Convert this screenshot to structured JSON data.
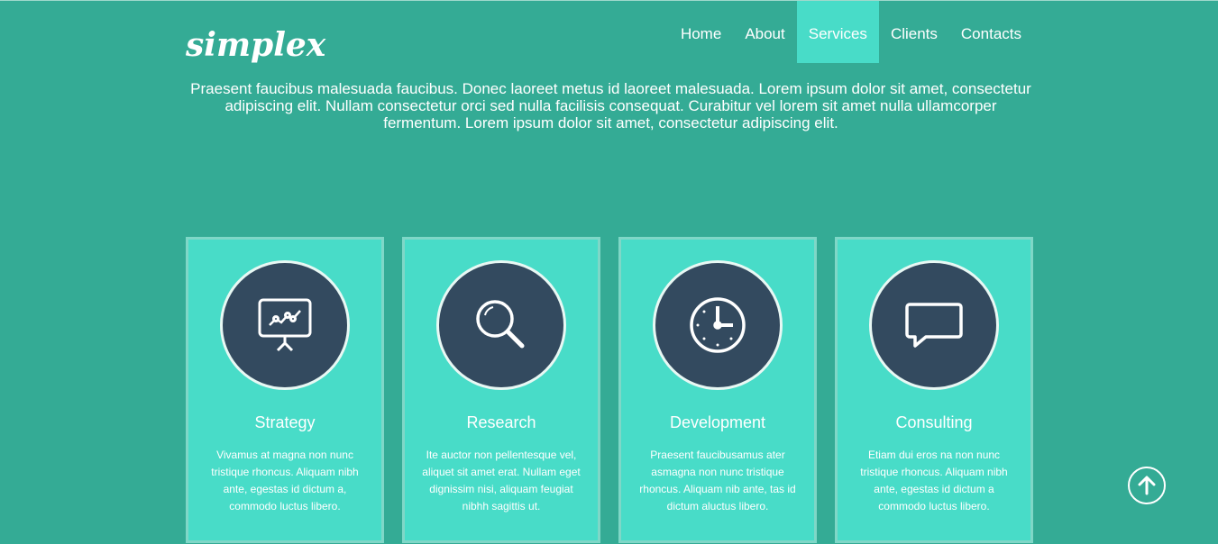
{
  "brand": {
    "logo": "simplex"
  },
  "nav": [
    {
      "label": "Home"
    },
    {
      "label": "About"
    },
    {
      "label": "Services"
    },
    {
      "label": "Clients"
    },
    {
      "label": "Contacts"
    }
  ],
  "intro": "Praesent faucibus malesuada faucibus. Donec laoreet metus id laoreet malesuada. Lorem ipsum dolor sit amet, consectetur adipiscing elit. Nullam consectetur orci sed nulla facilisis consequat. Curabitur vel lorem sit amet nulla ullamcorper fermentum. Lorem ipsum dolor sit amet, consectetur adipiscing elit.",
  "services": [
    {
      "title": "Strategy",
      "icon": "presentation-chart-icon",
      "text": "Vivamus at magna non nunc tristique rhoncus. Aliquam nibh ante, egestas id dictum a, commodo luctus libero."
    },
    {
      "title": "Research",
      "icon": "magnifier-icon",
      "text": "Ite auctor non pellentesque vel, aliquet sit amet erat. Nullam eget dignissim nisi, aliquam feugiat nibhh sagittis ut."
    },
    {
      "title": "Development",
      "icon": "clock-icon",
      "text": "Praesent faucibusamus ater asmagna non nunc tristique rhoncus. Aliquam nib ante, tas id dictum aluctus libero."
    },
    {
      "title": "Consulting",
      "icon": "speech-bubble-icon",
      "text": "Etiam dui eros na non nunc tristique rhoncus. Aliquam nibh ante, egestas id dictum a commodo luctus libero."
    }
  ],
  "colors": {
    "background": "#34ab95",
    "accent": "#48dcc8",
    "circle": "#334a5f"
  }
}
